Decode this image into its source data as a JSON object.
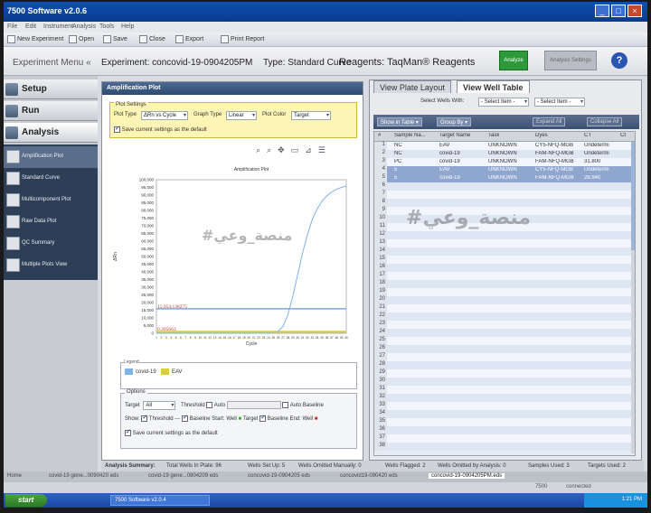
{
  "window": {
    "title": "7500 Software v2.0.6"
  },
  "menubar": {
    "items": [
      "File",
      "Edit",
      "Instrument",
      "Analysis",
      "Tools",
      "Help"
    ]
  },
  "toolbar": {
    "new_experiment": "New Experiment",
    "open": "Open",
    "save": "Save",
    "close": "Close",
    "export": "Export",
    "print_report": "Print Report"
  },
  "header": {
    "menu_label": "Experiment Menu",
    "experiment_label": "Experiment:",
    "experiment_name": "concovid-19-0904205PM",
    "type_label": "Type:",
    "type_value": "Standard Curve",
    "reagents_label": "Reagents:",
    "reagents_value": "TaqMan® Reagents",
    "analyze_button": "Analyze",
    "analysis_settings_button": "Analysis Settings",
    "help": "?"
  },
  "nav": {
    "setup": "Setup",
    "run": "Run",
    "analysis": "Analysis",
    "sub_items": [
      "Amplification Plot",
      "Standard Curve",
      "Multicomponent Plot",
      "Raw Data Plot",
      "QC Summary",
      "Multiple Plots View"
    ]
  },
  "amp_panel": {
    "title": "Amplification Plot",
    "plot_settings_tab": "Plot Settings",
    "plot_type_label": "Plot Type",
    "plot_type_value": "ΔRn vs Cycle",
    "graph_type_label": "Graph Type",
    "graph_type_value": "Linear",
    "plot_color_label": "Plot Color",
    "plot_color_value": "Target",
    "save_settings": "Save current settings as the default",
    "legend_title": "Legend",
    "options_title": "Options",
    "target_label": "Target",
    "target_value": "All",
    "threshold_label": "Threshold",
    "auto_label": "Auto",
    "auto_baseline_label": "Auto Baseline",
    "show_label": "Show:",
    "show_threshold": "Threshold",
    "baseline_start": "Baseline Start: Well",
    "target_label2": "Target",
    "baseline_end": "Baseline End: Well",
    "save_settings2": "Save current settings as the default"
  },
  "chart_data": {
    "type": "line",
    "title": "Amplification Plot",
    "xlabel": "Cycle",
    "ylabel": "ΔRn",
    "xlim": [
      1,
      40
    ],
    "ylim": [
      0,
      100000
    ],
    "x_ticks": [
      1,
      2,
      3,
      4,
      5,
      6,
      7,
      8,
      9,
      10,
      11,
      12,
      13,
      14,
      15,
      16,
      17,
      18,
      19,
      20,
      21,
      22,
      23,
      24,
      25,
      26,
      27,
      28,
      29,
      30,
      31,
      32,
      33,
      34,
      35,
      36,
      37,
      38,
      39,
      40
    ],
    "y_ticks": [
      0,
      5000,
      10000,
      15000,
      20000,
      25000,
      30000,
      35000,
      40000,
      45000,
      50000,
      55000,
      60000,
      65000,
      70000,
      75000,
      80000,
      85000,
      90000,
      95000,
      100000
    ],
    "y_tick_labels": [
      "0",
      "5,000",
      "10,000",
      "15,000",
      "20,000",
      "25,000",
      "30,000",
      "35,000",
      "40,000",
      "45,000",
      "50,000",
      "55,000",
      "60,000",
      "65,000",
      "70,000",
      "75,000",
      "80,000",
      "85,000",
      "90,000",
      "95,000",
      "100,000"
    ],
    "thresholds": [
      {
        "label": "15,954.138275",
        "value": 15954,
        "color": "#7fa4e0"
      },
      {
        "label": "0.395663",
        "value": 0.4,
        "color": "#d8cf3a"
      }
    ],
    "series": [
      {
        "name": "covid-19",
        "color": "#7fb4e6",
        "x": [
          1,
          2,
          3,
          4,
          5,
          6,
          7,
          8,
          9,
          10,
          11,
          12,
          13,
          14,
          15,
          16,
          17,
          18,
          19,
          20,
          21,
          22,
          23,
          24,
          25,
          26,
          27,
          28,
          29,
          30,
          31,
          32,
          33,
          34,
          35,
          36,
          37,
          38,
          39,
          40
        ],
        "y": [
          0,
          0,
          0,
          0,
          0,
          0,
          0,
          0,
          0,
          0,
          0,
          0,
          0,
          0,
          0,
          0,
          0,
          0,
          0,
          0,
          0,
          0,
          0,
          0,
          300,
          1200,
          4500,
          12000,
          24000,
          38000,
          52000,
          64000,
          74000,
          81000,
          86000,
          89500,
          92000,
          93800,
          95000,
          95800
        ]
      },
      {
        "name": "EAV",
        "color": "#d8cf3a",
        "x": [
          1,
          2,
          3,
          4,
          5,
          6,
          7,
          8,
          9,
          10,
          11,
          12,
          13,
          14,
          15,
          16,
          17,
          18,
          19,
          20,
          21,
          22,
          23,
          24,
          25,
          26,
          27,
          28,
          29,
          30,
          31,
          32,
          33,
          34,
          35,
          36,
          37,
          38,
          39,
          40
        ],
        "y": [
          0,
          0,
          0,
          0,
          0,
          0,
          0,
          0,
          0,
          0,
          0,
          0,
          0,
          0,
          0,
          0,
          0,
          0,
          0,
          0,
          0,
          0,
          0,
          0,
          0,
          0,
          0,
          0,
          0,
          0,
          0,
          0,
          0,
          0,
          0,
          0,
          0,
          0,
          0,
          0
        ]
      }
    ],
    "legend": [
      "covid-19",
      "EAV"
    ]
  },
  "right_panel": {
    "tab_plate_layout": "View Plate Layout",
    "tab_well_table": "View Well Table",
    "select_wells_label": "Select Wells With:",
    "select_item_1": "- Select Item -",
    "select_item_2": "- Select Item -",
    "show_in_table": "Show in Table",
    "group_by": "Group By",
    "expand_all": "Expand All",
    "collapse_all": "Collapse All"
  },
  "well_table": {
    "columns": [
      "#",
      "Sample Na...",
      "Target Name",
      "Task",
      "Dyes",
      "CT",
      "Ct"
    ],
    "rows": [
      {
        "num": "1",
        "sample": "NC",
        "target": "EAV",
        "task": "UNKNOWN",
        "dyes": "CY5-NFQ-MGB",
        "ct": "Undetermi",
        "sel": false
      },
      {
        "num": "2",
        "sample": "NC",
        "target": "covid-19",
        "task": "UNKNOWN",
        "dyes": "FAM-NFQ-MGB",
        "ct": "Undetermi",
        "sel": false
      },
      {
        "num": "3",
        "sample": "PC",
        "target": "covid-19",
        "task": "UNKNOWN",
        "dyes": "FAM-NFQ-MGB",
        "ct": "31.800",
        "sel": false
      },
      {
        "num": "4",
        "sample": "5",
        "target": "EAV",
        "task": "UNKNOWN",
        "dyes": "CY5-NFQ-MGB",
        "ct": "Undetermi",
        "sel": true
      },
      {
        "num": "5",
        "sample": "5",
        "target": "covid-19",
        "task": "UNKNOWN",
        "dyes": "FAM-NFQ-MGB",
        "ct": "28.940",
        "sel": true
      }
    ],
    "empty_rows": [
      "6",
      "7",
      "8",
      "9",
      "10",
      "11",
      "12",
      "13",
      "14",
      "15",
      "16",
      "17",
      "18",
      "19",
      "20",
      "21",
      "22",
      "23",
      "24",
      "25",
      "26",
      "27",
      "28",
      "29",
      "30",
      "31",
      "32",
      "33",
      "34",
      "35",
      "36",
      "37",
      "38"
    ]
  },
  "watermark": "#منصة_وعي",
  "summary": {
    "label": "Analysis Summary:",
    "total_wells": "Total Wells In Plate: 96",
    "wells_setup": "Wells Set Up: 5",
    "wells_omitted_manual": "Wells Omitted Manually: 0",
    "wells_flagged": "Wells Flagged: 2",
    "wells_omitted_analysis": "Wells Omitted by Analysis: 0",
    "samples_used": "Samples Used: 3",
    "targets_used": "Targets Used: 2"
  },
  "file_tabs": {
    "home": "Home",
    "tab1": "covid-19 gene...0090420 eds",
    "tab2": "covid-19 gene...0904209 eds",
    "tab3": "concovid-19-0904205 eds",
    "tab4": "concovid19-090420 eds",
    "active": "concovid-19-0904205PM.eds"
  },
  "statusline": {
    "instrument": "7500",
    "connection": "connected"
  },
  "taskbar": {
    "start": "start",
    "app": "7500 Software v2.0.4",
    "time": "1:21 PM"
  }
}
